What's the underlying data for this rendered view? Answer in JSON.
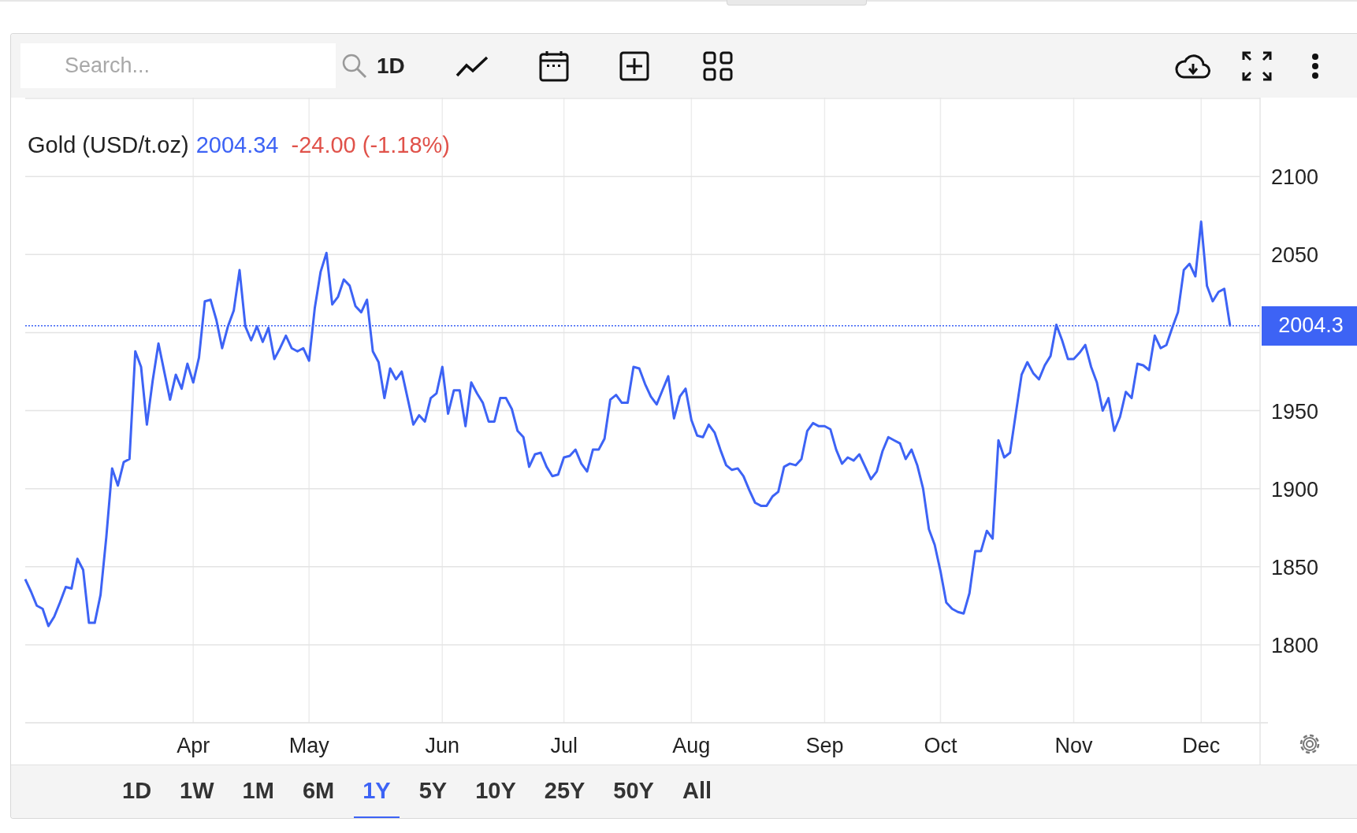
{
  "toolbar": {
    "search": {
      "placeholder": "Search..."
    },
    "interval": "1D"
  },
  "chart": {
    "price": "2004.34",
    "change": "-24.00 (-1.18%)",
    "chart_data": {
      "type": "line",
      "grid": true,
      "categories": [
        null,
        null,
        null,
        null,
        null,
        null,
        null,
        null,
        null,
        null,
        null,
        null,
        null,
        null,
        null,
        null,
        null,
        null,
        null,
        null,
        null,
        null,
        null,
        null,
        null,
        null,
        null,
        null,
        null,
        "Apr",
        null,
        null,
        null,
        null,
        null,
        null,
        null,
        null,
        null,
        null,
        null,
        null,
        null,
        null,
        null,
        null,
        null,
        null,
        null,
        "May",
        null,
        null,
        null,
        null,
        null,
        null,
        null,
        null,
        null,
        null,
        null,
        null,
        null,
        null,
        null,
        null,
        null,
        null,
        null,
        null,
        null,
        null,
        "Jun",
        null,
        null,
        null,
        null,
        null,
        null,
        null,
        null,
        null,
        null,
        null,
        null,
        null,
        null,
        null,
        null,
        null,
        null,
        null,
        null,
        "Jul",
        null,
        null,
        null,
        null,
        null,
        null,
        null,
        null,
        null,
        null,
        null,
        null,
        null,
        null,
        null,
        null,
        null,
        null,
        null,
        null,
        null,
        "Aug",
        null,
        null,
        null,
        null,
        null,
        null,
        null,
        null,
        null,
        null,
        null,
        null,
        null,
        null,
        null,
        null,
        null,
        null,
        null,
        null,
        null,
        null,
        "Sep",
        null,
        null,
        null,
        null,
        null,
        null,
        null,
        null,
        null,
        null,
        null,
        null,
        null,
        null,
        null,
        null,
        null,
        null,
        null,
        "Oct",
        null,
        null,
        null,
        null,
        null,
        null,
        null,
        null,
        null,
        null,
        null,
        null,
        null,
        null,
        null,
        null,
        null,
        null,
        null,
        null,
        null,
        null,
        "Nov",
        null,
        null,
        null,
        null,
        null,
        null,
        null,
        null,
        null,
        null,
        null,
        null,
        null,
        null,
        null,
        null,
        null,
        null,
        null,
        null,
        null,
        "Dec",
        null,
        null,
        null,
        null,
        null
      ],
      "series": [
        {
          "name": "Gold (USD/t.oz)",
          "color": "#3d63f5",
          "values": [
            1842,
            1834,
            1825,
            1823,
            1812,
            1818,
            1827,
            1837,
            1836,
            1855,
            1848,
            1814,
            1814,
            1832,
            1869,
            1913,
            1902,
            1917,
            1919,
            1988,
            1978,
            1941,
            1969,
            1993,
            1975,
            1957,
            1973,
            1964,
            1980,
            1968,
            1984,
            2020,
            2021,
            2008,
            1990,
            2004,
            2014,
            2040,
            2004,
            1995,
            2004,
            1994,
            2003,
            1983,
            1990,
            1998,
            1990,
            1988,
            1990,
            1982,
            2016,
            2039,
            2051,
            2018,
            2023,
            2034,
            2030,
            2017,
            2013,
            2021,
            1988,
            1981,
            1958,
            1977,
            1970,
            1975,
            1958,
            1941,
            1947,
            1943,
            1958,
            1961,
            1978,
            1948,
            1963,
            1963,
            1940,
            1968,
            1961,
            1955,
            1943,
            1943,
            1958,
            1958,
            1951,
            1937,
            1933,
            1914,
            1922,
            1923,
            1914,
            1908,
            1909,
            1920,
            1921,
            1925,
            1916,
            1911,
            1925,
            1925,
            1932,
            1957,
            1960,
            1955,
            1955,
            1978,
            1977,
            1967,
            1959,
            1954,
            1963,
            1972,
            1945,
            1959,
            1964,
            1944,
            1934,
            1933,
            1941,
            1936,
            1925,
            1915,
            1912,
            1913,
            1908,
            1899,
            1891,
            1889,
            1889,
            1895,
            1898,
            1914,
            1916,
            1915,
            1919,
            1937,
            1942,
            1940,
            1940,
            1938,
            1925,
            1916,
            1920,
            1918,
            1922,
            1914,
            1906,
            1911,
            1924,
            1933,
            1931,
            1929,
            1919,
            1925,
            1915,
            1900,
            1874,
            1864,
            1847,
            1827,
            1823,
            1821,
            1820,
            1833,
            1860,
            1860,
            1873,
            1868,
            1931,
            1920,
            1923,
            1948,
            1973,
            1981,
            1974,
            1970,
            1979,
            1985,
            2005,
            1995,
            1983,
            1983,
            1987,
            1992,
            1978,
            1968,
            1950,
            1958,
            1937,
            1946,
            1962,
            1958,
            1980,
            1979,
            1976,
            1998,
            1990,
            1992,
            2003,
            2013,
            2040,
            2044,
            2036,
            2071,
            2030,
            2020,
            2026,
            2028,
            2004
          ]
        }
      ],
      "ylim": [
        1750,
        2150
      ],
      "yticks": [
        1800,
        1850,
        1900,
        1950,
        2050,
        2100
      ],
      "ref_lines": [
        {
          "axis": "y",
          "value": 2004.34,
          "label": "2004.3"
        }
      ]
    }
  },
  "ranges": [
    {
      "label": "1D",
      "selected": false
    },
    {
      "label": "1W",
      "selected": false
    },
    {
      "label": "1M",
      "selected": false
    },
    {
      "label": "6M",
      "selected": false
    },
    {
      "label": "1Y",
      "selected": true
    },
    {
      "label": "5Y",
      "selected": false
    },
    {
      "label": "10Y",
      "selected": false
    },
    {
      "label": "25Y",
      "selected": false
    },
    {
      "label": "50Y",
      "selected": false
    },
    {
      "label": "All",
      "selected": false
    }
  ]
}
